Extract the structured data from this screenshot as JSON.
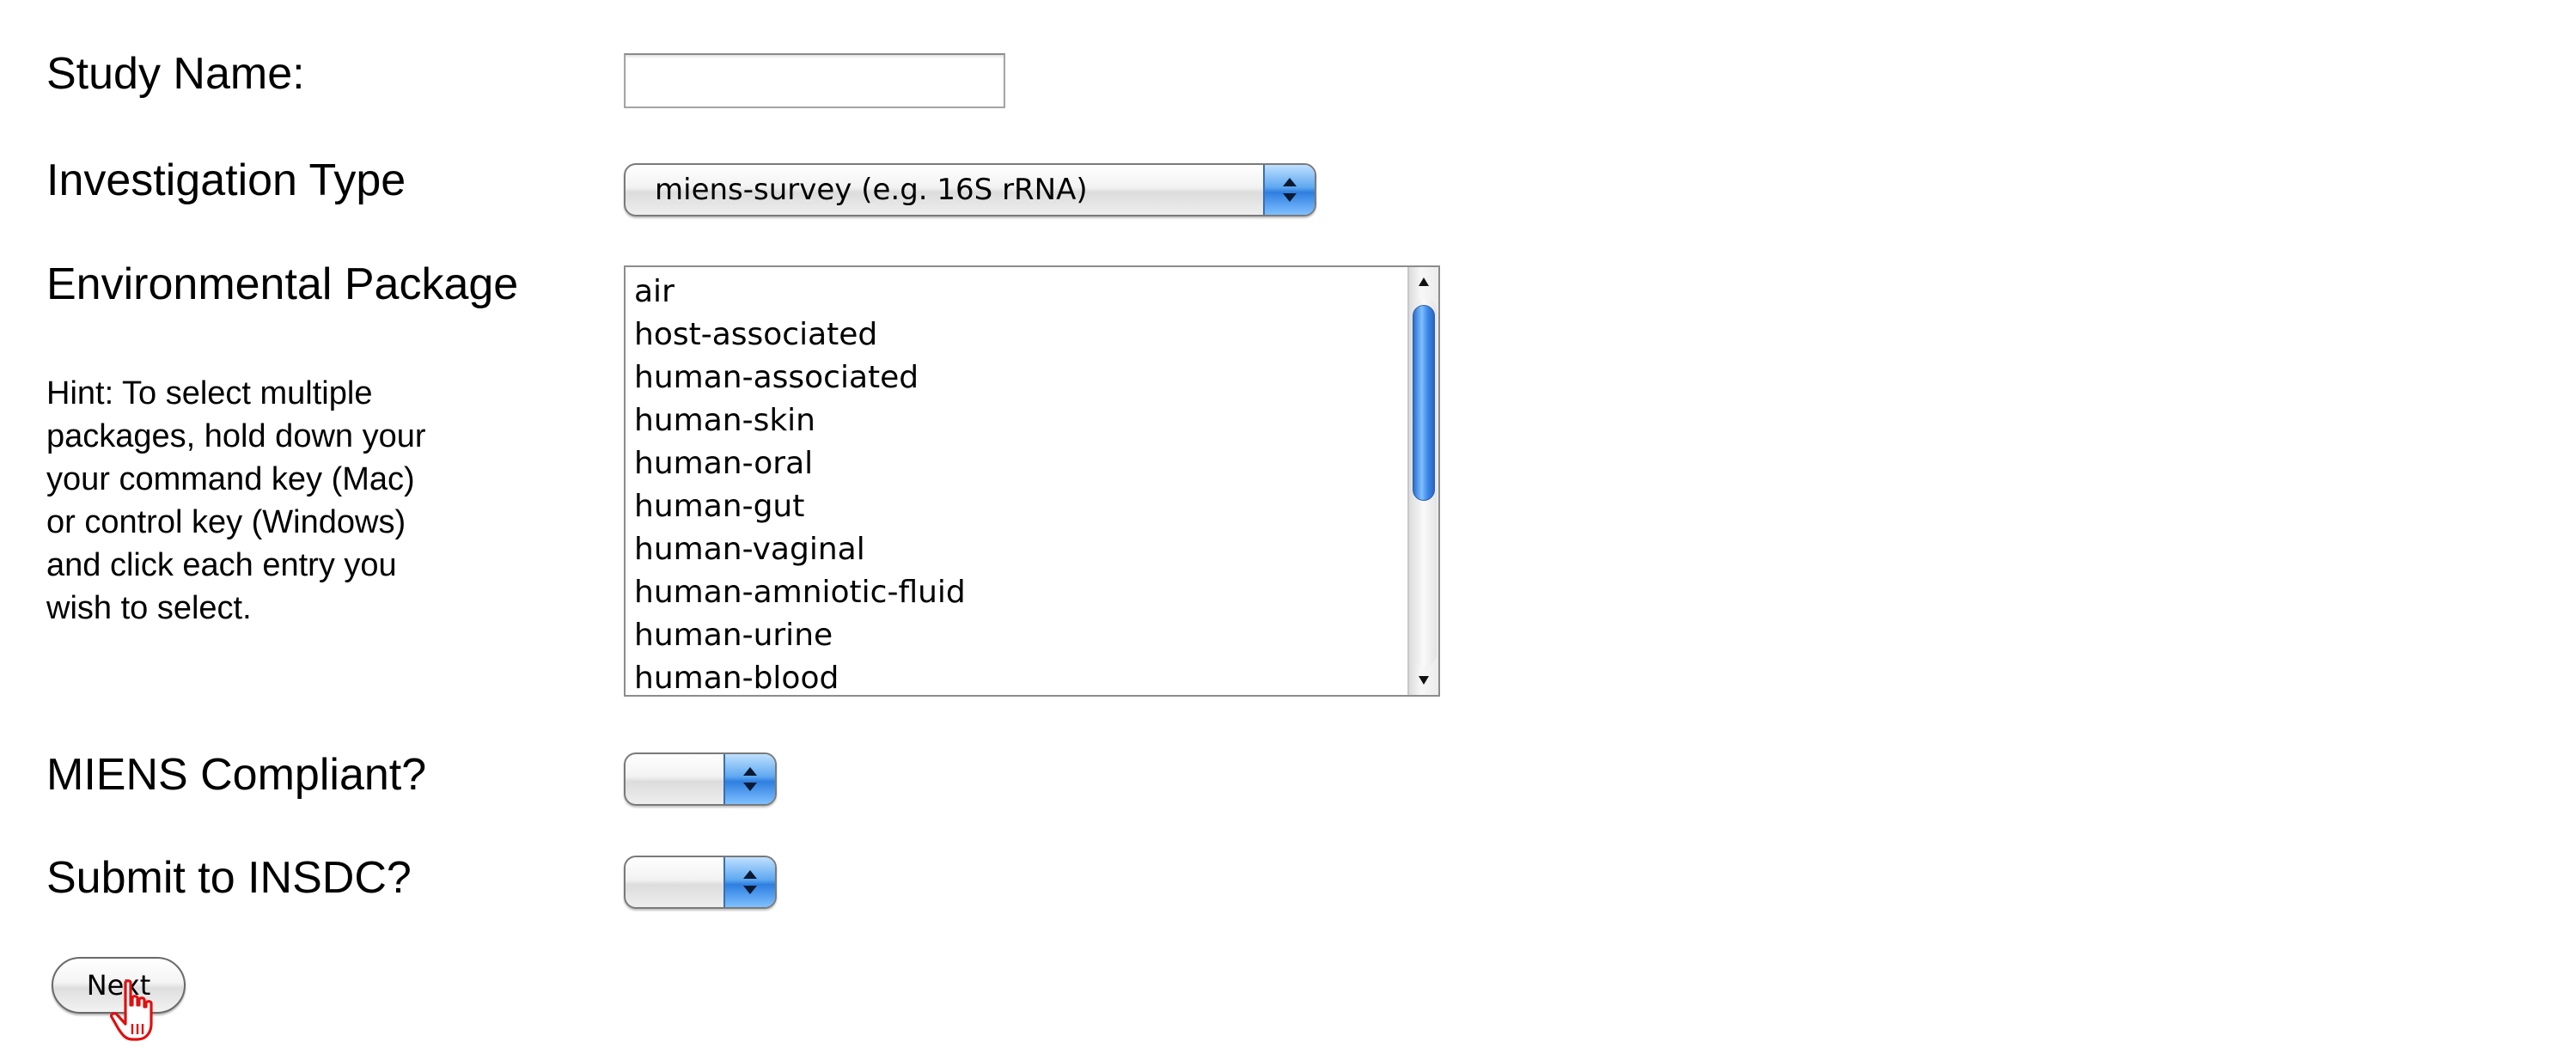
{
  "form": {
    "study_name": {
      "label": "Study Name:",
      "value": ""
    },
    "investigation_type": {
      "label": "Investigation Type",
      "selected": "miens-survey (e.g. 16S rRNA)"
    },
    "environmental_package": {
      "label": "Environmental Package",
      "hint_lines": [
        "Hint: To select multiple",
        "packages, hold down your",
        "your command key (Mac)",
        "or control key (Windows)",
        "and click each entry you",
        "wish to select."
      ],
      "options": [
        "air",
        "host-associated",
        "human-associated",
        "human-skin",
        "human-oral",
        "human-gut",
        "human-vaginal",
        "human-amniotic-fluid",
        "human-urine",
        "human-blood"
      ]
    },
    "miens_compliant": {
      "label": "MIENS Compliant?",
      "selected": ""
    },
    "submit_to_insdc": {
      "label": "Submit to INSDC?",
      "selected": ""
    },
    "next_button": {
      "label": "Next"
    }
  },
  "colors": {
    "select_arrow_accent": "#2f7fe0",
    "scroll_thumb": "#3b86e6",
    "cursor_red": "#e01010"
  },
  "icons": {
    "select_arrow": "up-down-arrows-icon",
    "cursor": "pointing-hand-cursor-icon"
  }
}
